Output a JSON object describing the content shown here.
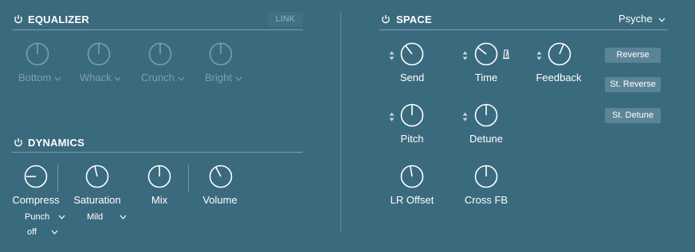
{
  "equalizer": {
    "title": "EQUALIZER",
    "link_label": "LINK",
    "bands": [
      {
        "label": "Bottom"
      },
      {
        "label": "Whack"
      },
      {
        "label": "Crunch"
      },
      {
        "label": "Bright"
      }
    ]
  },
  "dynamics": {
    "title": "DYNAMICS",
    "knobs": [
      {
        "label": "Compress"
      },
      {
        "label": "Saturation"
      },
      {
        "label": "Mix"
      },
      {
        "label": "Volume"
      }
    ],
    "compress_mode": "Punch",
    "compress_sub": "off",
    "saturation_mode": "Mild"
  },
  "space": {
    "title": "SPACE",
    "preset": "Psyche",
    "knobs": [
      {
        "label": "Send"
      },
      {
        "label": "Time"
      },
      {
        "label": "Feedback"
      },
      {
        "label": "Pitch"
      },
      {
        "label": "Detune"
      },
      {
        "label": "LR Offset"
      },
      {
        "label": "Cross FB"
      }
    ],
    "buttons": [
      {
        "label": "Reverse"
      },
      {
        "label": "St. Reverse"
      },
      {
        "label": "St. Detune"
      }
    ]
  },
  "colors": {
    "background": "#3a6a7e",
    "button": "#5b8497",
    "text": "#ffffff"
  }
}
